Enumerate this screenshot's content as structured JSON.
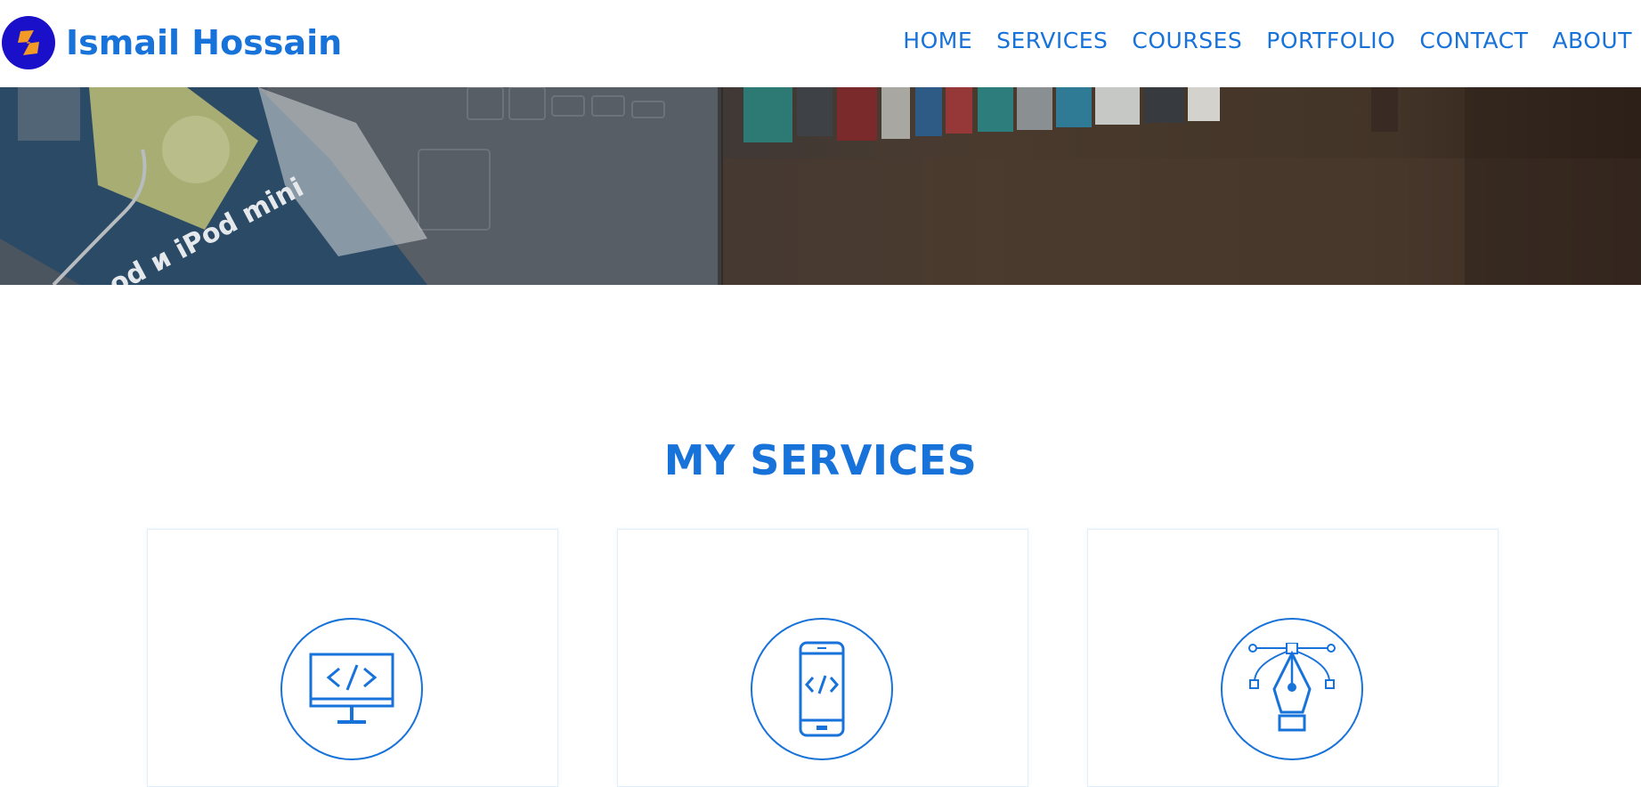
{
  "brand": {
    "name": "Ismail Hossain",
    "logo_icon": "lightning-s-logo-icon",
    "logo_bg": "#1a10c9",
    "logo_fg": "#f39a26"
  },
  "nav": {
    "items": [
      {
        "label": "HOME"
      },
      {
        "label": "SERVICES"
      },
      {
        "label": "COURSES"
      },
      {
        "label": "PORTFOLIO"
      },
      {
        "label": "CONTACT"
      },
      {
        "label": "ABOUT"
      }
    ]
  },
  "hero": {
    "image": "desk-with-laptop-ipod-manual-and-books-photo",
    "book_text": "od и iPod mini"
  },
  "services": {
    "title": "MY SERVICES",
    "cards": [
      {
        "icon": "web-development-monitor-code-icon"
      },
      {
        "icon": "mobile-app-code-icon"
      },
      {
        "icon": "graphic-design-pen-tool-icon"
      }
    ]
  },
  "colors": {
    "accent": "#1772d9",
    "background": "#ffffff"
  }
}
